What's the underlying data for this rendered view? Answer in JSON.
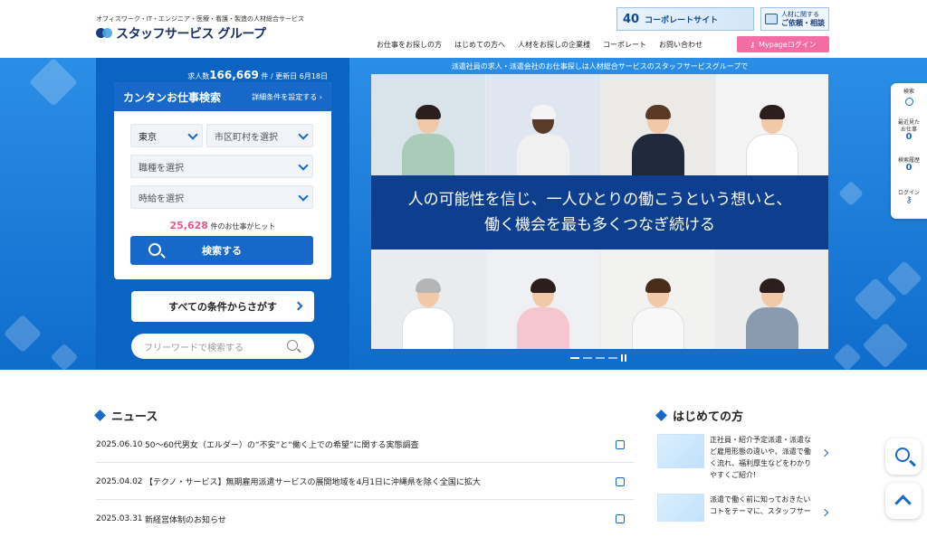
{
  "header": {
    "logo_sub": "オフィスワーク・IT・エンジニア・医療・看護・製造の人材総合サービス",
    "logo_text": "スタッフサービス グループ",
    "corp_banner": {
      "num": "40",
      "text": "コーポレートサイト"
    },
    "inquiry": {
      "line1": "人材に関する",
      "line2": "ご依頼・相談"
    },
    "nav": [
      "お仕事をお探しの方",
      "はじめての方へ",
      "人材をお探しの企業様",
      "コーポレート",
      "お問い合わせ"
    ],
    "mypage": "Mypageログイン"
  },
  "hero": {
    "tagline": "派遣社員の求人・派遣会社のお仕事探しは人材総合サービスのスタッフサービスグループで",
    "job_count": {
      "prefix": "求人数",
      "count": "166,669",
      "suffix": "件 / 更新日 6月18日"
    },
    "message_line1": "人の可能性を信じ、一人ひとりの働こうという想いと、",
    "message_line2": "働く機会を最も多くつなぎ続ける"
  },
  "search": {
    "title": "カンタンお仕事検索",
    "detail_link": "詳細条件を設定する",
    "prefecture": "東京",
    "city_placeholder": "市区町村を選択",
    "job_type_placeholder": "職種を選択",
    "wage_placeholder": "時給を選択",
    "hit_count": "25,628",
    "hit_suffix": "件のお仕事がヒット",
    "button": "検索する",
    "all_conditions": "すべての条件からさがす",
    "freeword_placeholder": "フリーワードで検索する"
  },
  "side_panel": {
    "search": "検索",
    "recent_label_1": "最近見た",
    "recent_label_2": "お仕事",
    "recent_count": "0",
    "history_label": "検索履歴",
    "history_count": "0",
    "login": "ログイン"
  },
  "news": {
    "title": "ニュース",
    "items": [
      {
        "date": "2025.06.10",
        "title": "50～60代男女（エルダー）の“不安”と“働く上での希望”に関する実態調査"
      },
      {
        "date": "2025.04.02",
        "title": "【テクノ・サービス】無期雇用派遣サービスの展開地域を4月1日に沖縄県を除く全国に拡大"
      },
      {
        "date": "2025.03.31",
        "title": "新経営体制のお知らせ"
      }
    ]
  },
  "beginners": {
    "title": "はじめての方",
    "items": [
      {
        "text": "正社員・紹介予定派遣・派遣など雇用形態の違いや、派遣で働く流れ、福利厚生などをわかりやすくご紹介!"
      },
      {
        "text": "派遣で働く前に知っておきたいコトをテーマに、スタッフサー"
      }
    ]
  },
  "colors": {
    "primary": "#1768c9",
    "pink": "#f36ca3",
    "navy": "#0e3f8e"
  }
}
